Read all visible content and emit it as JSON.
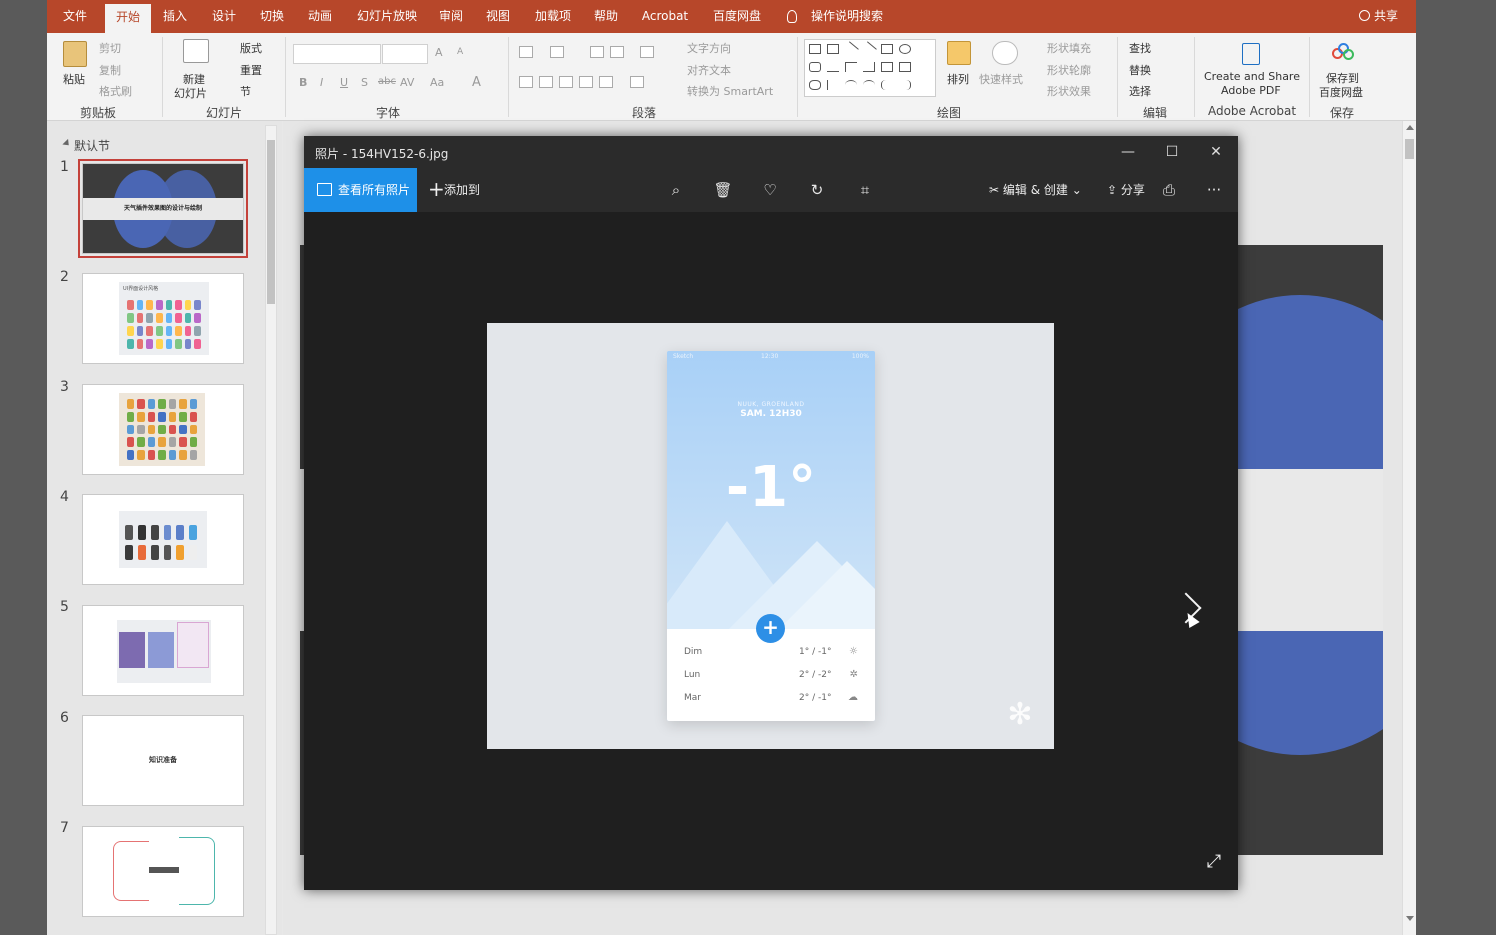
{
  "ppt": {
    "tabs": [
      "文件",
      "开始",
      "插入",
      "设计",
      "切换",
      "动画",
      "幻灯片放映",
      "审阅",
      "视图",
      "加载项",
      "帮助",
      "Acrobat",
      "百度网盘",
      "操作说明搜索"
    ],
    "active_tab": "开始",
    "share_label": "共享",
    "ribbon": {
      "clipboard": {
        "paste": "粘贴",
        "cut": "剪切",
        "copy": "复制",
        "format_painter": "格式刷",
        "group_label": "剪贴板"
      },
      "slides": {
        "new_slide": "新建",
        "new_slide_2": "幻灯片",
        "layout": "版式",
        "reset": "重置",
        "section": "节",
        "group_label": "幻灯片"
      },
      "font": {
        "group_label": "字体",
        "bold": "B",
        "italic": "I",
        "underline": "U",
        "shadow": "S",
        "strike": "abc",
        "spacing": "AV",
        "case": "Aa",
        "grow": "A",
        "shrink": "A"
      },
      "paragraph": {
        "text_direction": "文字方向",
        "align_text": "对齐文本",
        "smartart": "转换为 SmartArt",
        "group_label": "段落"
      },
      "drawing": {
        "arrange": "排列",
        "quick_styles": "快速样式",
        "shape_fill": "形状填充",
        "shape_outline": "形状轮廓",
        "shape_effects": "形状效果",
        "group_label": "绘图"
      },
      "editing": {
        "find": "查找",
        "replace": "替换",
        "select": "选择",
        "group_label": "编辑"
      },
      "acrobat": {
        "line1": "Create and Share",
        "line2": "Adobe PDF",
        "group_label": "Adobe Acrobat"
      },
      "save": {
        "line1": "保存到",
        "line2": "百度网盘",
        "group_label": "保存"
      }
    },
    "section_name": "默认节",
    "slides": [
      {
        "num": "1",
        "title": "天气插件效果图的设计与绘制",
        "subtitle": ""
      },
      {
        "num": "2",
        "title": "UI界面设计风格"
      },
      {
        "num": "3",
        "title": ""
      },
      {
        "num": "4",
        "title": ""
      },
      {
        "num": "5",
        "title": ""
      },
      {
        "num": "6",
        "title": "知识准备"
      },
      {
        "num": "7",
        "title": ""
      }
    ]
  },
  "photos": {
    "title": "照片 - 154HV152-6.jpg",
    "view_all": "查看所有照片",
    "add_to": "添加到",
    "edit_create": "编辑 & 创建",
    "share": "分享",
    "more": "···",
    "icons": [
      "zoom-icon",
      "delete-icon",
      "favorite-icon",
      "rotate-icon",
      "crop-icon",
      "print-icon"
    ],
    "image": {
      "status_left": "Sketch",
      "status_center": "12:30",
      "status_right": "100%",
      "location": "NUUK, GROENLAND",
      "time": "SAM. 12H30",
      "temperature": "-1°",
      "forecast": [
        {
          "day": "Dim",
          "temp": "1° / -1°",
          "icon": "☼"
        },
        {
          "day": "Lun",
          "temp": "2° / -2°",
          "icon": "✲"
        },
        {
          "day": "Mar",
          "temp": "2° / -1°",
          "icon": "☁"
        }
      ]
    }
  },
  "colors": {
    "accent": "#b7472a",
    "photos_blue": "#1e90e8",
    "slide_blue": "#4a66b4"
  }
}
